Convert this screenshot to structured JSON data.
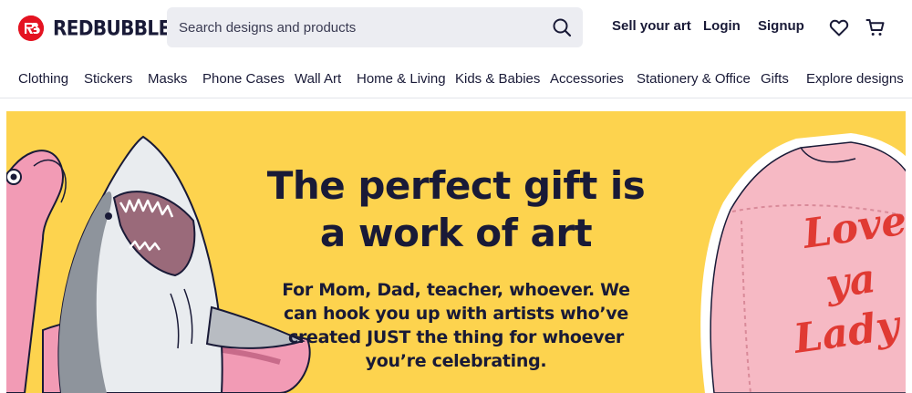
{
  "brand": {
    "name": "REDBUBBLE",
    "accent": "#e41321"
  },
  "search": {
    "placeholder": "Search designs and products",
    "value": "",
    "icon": "search-icon"
  },
  "header_links": {
    "sell": "Sell your art",
    "login": "Login",
    "signup": "Signup"
  },
  "header_icons": [
    "heart-icon",
    "cart-icon"
  ],
  "nav": {
    "items": [
      "Clothing",
      "Stickers",
      "Masks",
      "Phone Cases",
      "Wall Art",
      "Home & Living",
      "Kids & Babies",
      "Accessories",
      "Stationery & Office",
      "Gifts",
      "Explore designs"
    ]
  },
  "hero": {
    "background": "#fdd34e",
    "title": "The perfect gift is a work of art",
    "subtitle": "For Mom, Dad, teacher, whoever. We can hook you up with artists who’ve created JUST the thing for whoever you’re celebrating.",
    "art_left": "shark-in-pink-flamingo-float-illustration",
    "art_right": "pink-jacket-illustration",
    "art_right_text": "Love ya Lady"
  }
}
